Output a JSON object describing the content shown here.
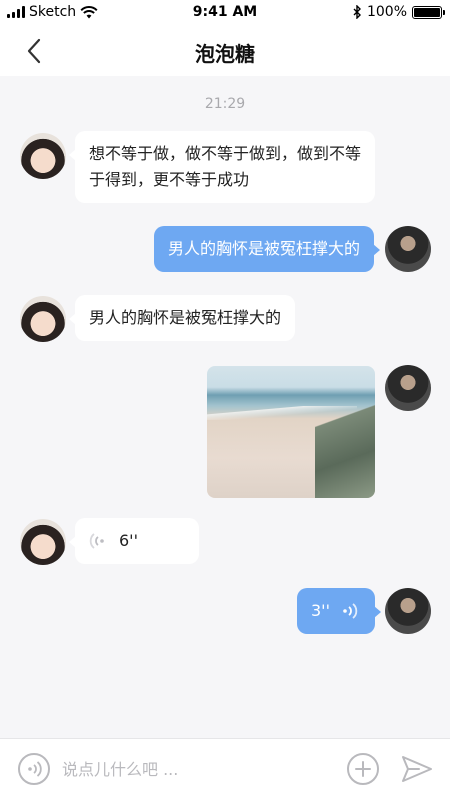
{
  "status_bar": {
    "carrier": "Sketch",
    "time": "9:41 AM",
    "battery": "100%",
    "icons": [
      "signal-icon",
      "wifi-icon",
      "bluetooth-icon",
      "battery-icon"
    ]
  },
  "nav": {
    "title": "泡泡糖",
    "back_icon": "chevron-left-icon"
  },
  "chat": {
    "timestamp": "21:29",
    "messages": [
      {
        "side": "in",
        "type": "text",
        "text": "想不等于做，做不等于做到，做到不等于得到，更不等于成功"
      },
      {
        "side": "out",
        "type": "text",
        "text": "男人的胸怀是被冤枉撑大的"
      },
      {
        "side": "in",
        "type": "text",
        "text": "男人的胸怀是被冤枉撑大的"
      },
      {
        "side": "out",
        "type": "image"
      },
      {
        "side": "in",
        "type": "voice",
        "duration": "6''"
      },
      {
        "side": "out",
        "type": "voice",
        "duration": "3''"
      }
    ]
  },
  "input_bar": {
    "placeholder": "说点儿什么吧 ...",
    "voice_icon": "voice-icon",
    "plus_icon": "plus-icon",
    "send_icon": "send-icon"
  },
  "colors": {
    "outgoing_bubble": "#6ea8f2",
    "incoming_bubble": "#ffffff",
    "background": "#f6f6f8"
  }
}
